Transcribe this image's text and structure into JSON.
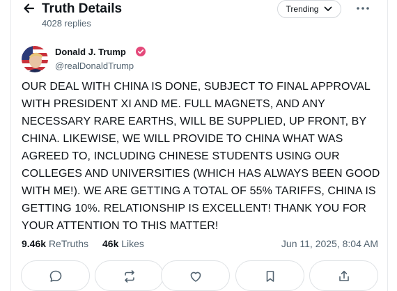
{
  "header": {
    "title": "Truth Details",
    "replies": "4028 replies",
    "sort_label": "Trending"
  },
  "post": {
    "author_name": "Donald J. Trump",
    "author_handle": "@realDonaldTrump",
    "verified": true,
    "text": "OUR DEAL WITH CHINA IS DONE, SUBJECT TO FINAL APPROVAL WITH PRESIDENT XI AND ME. FULL MAGNETS, AND ANY NECESSARY RARE EARTHS, WILL BE SUPPLIED, UP FRONT, BY CHINA. LIKEWISE, WE WILL PROVIDE TO CHINA WHAT WAS AGREED TO, INCLUDING CHINESE STUDENTS USING OUR COLLEGES AND UNIVERSITIES (WHICH HAS ALWAYS BEEN GOOD WITH ME!). WE ARE GETTING A TOTAL OF 55% TARIFFS, CHINA IS GETTING 10%. RELATIONSHIP IS EXCELLENT! THANK YOU FOR YOUR ATTENTION TO THIS MATTER!",
    "retruths_count": "9.46k",
    "retruths_label": "ReTruths",
    "likes_count": "46k",
    "likes_label": "Likes",
    "timestamp": "Jun 11, 2025, 8:04 AM"
  },
  "actions": [
    {
      "icon": "reply-icon"
    },
    {
      "icon": "retruth-icon"
    },
    {
      "icon": "like-icon"
    },
    {
      "icon": "bookmark-icon"
    },
    {
      "icon": "share-icon"
    }
  ],
  "colors": {
    "text": "#0f1419",
    "muted": "#536471",
    "border": "#dfe2e5",
    "verified": "#e4497a"
  }
}
